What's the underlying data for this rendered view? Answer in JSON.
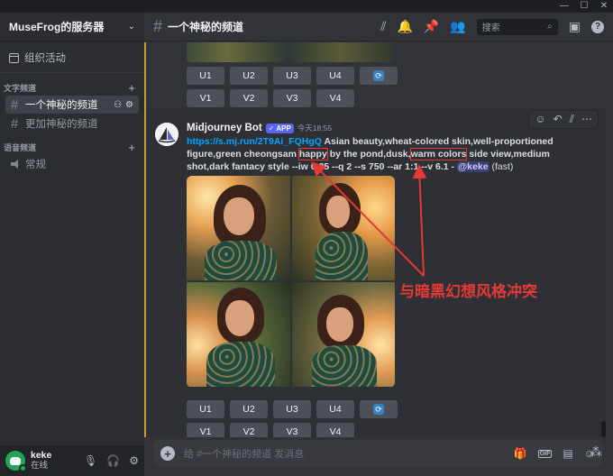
{
  "window": {
    "minimize": "—",
    "maximize": "☐",
    "close": "✕"
  },
  "server": {
    "name": "MuseFrog的服务器"
  },
  "sidebar": {
    "events_label": "组织活动",
    "text_category": "文字频道",
    "voice_category": "语音频道",
    "text_channels": [
      {
        "name": "一个神秘的频道"
      },
      {
        "name": "更加神秘的频道"
      }
    ],
    "voice_channels": [
      {
        "name": "常规"
      }
    ]
  },
  "user": {
    "name": "keke",
    "status": "在线"
  },
  "topbar": {
    "channel": "一个神秘的频道",
    "search_placeholder": "搜索"
  },
  "buttons": {
    "upscale": [
      "U1",
      "U2",
      "U3",
      "U4"
    ],
    "variation": [
      "V1",
      "V2",
      "V3",
      "V4"
    ],
    "reroll_icon": "refresh-icon"
  },
  "message": {
    "author": "Midjourney Bot",
    "badge": "✓ APP",
    "timestamp": "今天18:55",
    "link": "https://s.mj.run/2T9Ai_FQHgQ",
    "prompt_before_happy": " Asian beauty,wheat-colored skin,well-proportioned figure,green cheongsam ",
    "happy": "happy",
    "prompt_between": " by the pond,dusk,",
    "warm": "warm colors",
    "prompt_after": " side view,medium shot,dark fantacy style --iw 0.25 --q 2 --s 750 --ar 1:1 --v 6.1 - ",
    "mention": "@keke",
    "suffix": " (fast)"
  },
  "annotation": {
    "text": "与暗黑幻想风格冲突",
    "color": "#e53935"
  },
  "composer": {
    "placeholder": "给 #一个神秘的频道 发消息"
  }
}
